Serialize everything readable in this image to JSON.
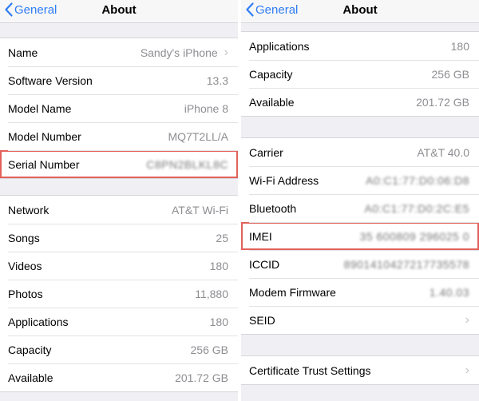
{
  "left": {
    "back_label": "General",
    "title": "About",
    "sections": [
      [
        {
          "label": "Name",
          "value": "Sandy's iPhone",
          "chevron": true
        },
        {
          "label": "Software Version",
          "value": "13.3"
        },
        {
          "label": "Model Name",
          "value": "iPhone 8"
        },
        {
          "label": "Model Number",
          "value": "MQ7T2LL/A"
        },
        {
          "label": "Serial Number",
          "value": "C8PN2BLKL8C",
          "blurred": true,
          "highlighted": true
        }
      ],
      [
        {
          "label": "Network",
          "value": "AT&T Wi-Fi"
        },
        {
          "label": "Songs",
          "value": "25"
        },
        {
          "label": "Videos",
          "value": "180"
        },
        {
          "label": "Photos",
          "value": "11,880"
        },
        {
          "label": "Applications",
          "value": "180"
        },
        {
          "label": "Capacity",
          "value": "256 GB"
        },
        {
          "label": "Available",
          "value": "201.72 GB"
        }
      ]
    ]
  },
  "right": {
    "back_label": "General",
    "title": "About",
    "sections": [
      [
        {
          "label": "Applications",
          "value": "180"
        },
        {
          "label": "Capacity",
          "value": "256 GB"
        },
        {
          "label": "Available",
          "value": "201.72 GB"
        }
      ],
      [
        {
          "label": "Carrier",
          "value": "AT&T 40.0"
        },
        {
          "label": "Wi-Fi Address",
          "value": "A0:C1:77:D0:06:D8",
          "blurred": true
        },
        {
          "label": "Bluetooth",
          "value": "A0:C1:77:D0:2C:E5",
          "blurred": true
        },
        {
          "label": "IMEI",
          "value": "35 600809 296025 0",
          "blurred": true,
          "highlighted": true
        },
        {
          "label": "ICCID",
          "value": "8901410427217735578",
          "blurred": true
        },
        {
          "label": "Modem Firmware",
          "value": "1.40.03",
          "blurred": true
        },
        {
          "label": "SEID",
          "value": "",
          "chevron": true
        }
      ],
      [
        {
          "label": "Certificate Trust Settings",
          "value": "",
          "chevron": true
        }
      ]
    ]
  }
}
